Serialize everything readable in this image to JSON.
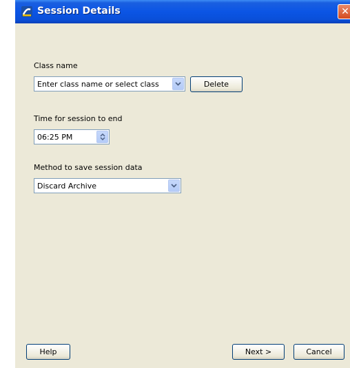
{
  "window": {
    "title": "Session Details",
    "close_glyph": "✕"
  },
  "class_name": {
    "label": "Class name",
    "combo_value": "Enter class name or select class",
    "delete_button": "Delete"
  },
  "session_end": {
    "label": "Time for session to end",
    "time_value": "06:25 PM"
  },
  "save_method": {
    "label": "Method to save session data",
    "selected": "Discard Archive"
  },
  "footer": {
    "help_button": "Help",
    "next_button": "Next >",
    "cancel_button": "Cancel"
  },
  "icons": {
    "app": "app-logo-icon",
    "close": "close-icon",
    "dropdown": "chevron-down-icon",
    "spinner": "up-down-arrows-icon"
  },
  "colors": {
    "titlebar": "#0b55e5",
    "dialog_bg": "#ece9d8",
    "close_button": "#d44a1e",
    "input_border": "#7f9db9"
  }
}
